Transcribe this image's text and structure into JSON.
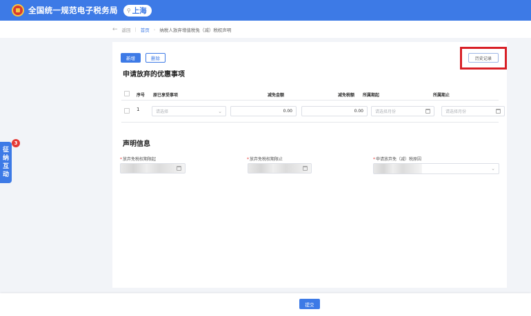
{
  "header": {
    "title": "全国统一规范电子税务局",
    "region": "上海",
    "brand_color": "#3d7ae6"
  },
  "breadcrumb": {
    "back": "返回",
    "home": "首页",
    "current": "纳税人放弃增值税免（减）税权声明"
  },
  "toolbar": {
    "add_label": "新增",
    "delete_label": "删除",
    "history_label": "历史记录",
    "highlight_color": "#d81f26"
  },
  "section_preferences": {
    "title": "申请放弃的优惠事项",
    "columns": [
      "序号",
      "原已享受事项",
      "减免金额",
      "减免税额",
      "所属期起",
      "所属期止"
    ],
    "rows": [
      {
        "index": "1",
        "item_placeholder": "请选择",
        "exempt_amount": "0.00",
        "exempt_tax": "0.00",
        "period_start_placeholder": "请选择月份",
        "period_end_placeholder": "请选择月份"
      }
    ]
  },
  "section_statement": {
    "title": "声明信息",
    "field_start_label": "放弃免税权期限起",
    "field_end_label": "放弃免税权期限止",
    "field_reason_label": "申请放弃免（减）税原因"
  },
  "side_tab": {
    "label_1": "征",
    "label_2": "纳",
    "label_3": "互",
    "label_4": "动",
    "badge": "3"
  },
  "footer": {
    "submit_label": "提交"
  }
}
